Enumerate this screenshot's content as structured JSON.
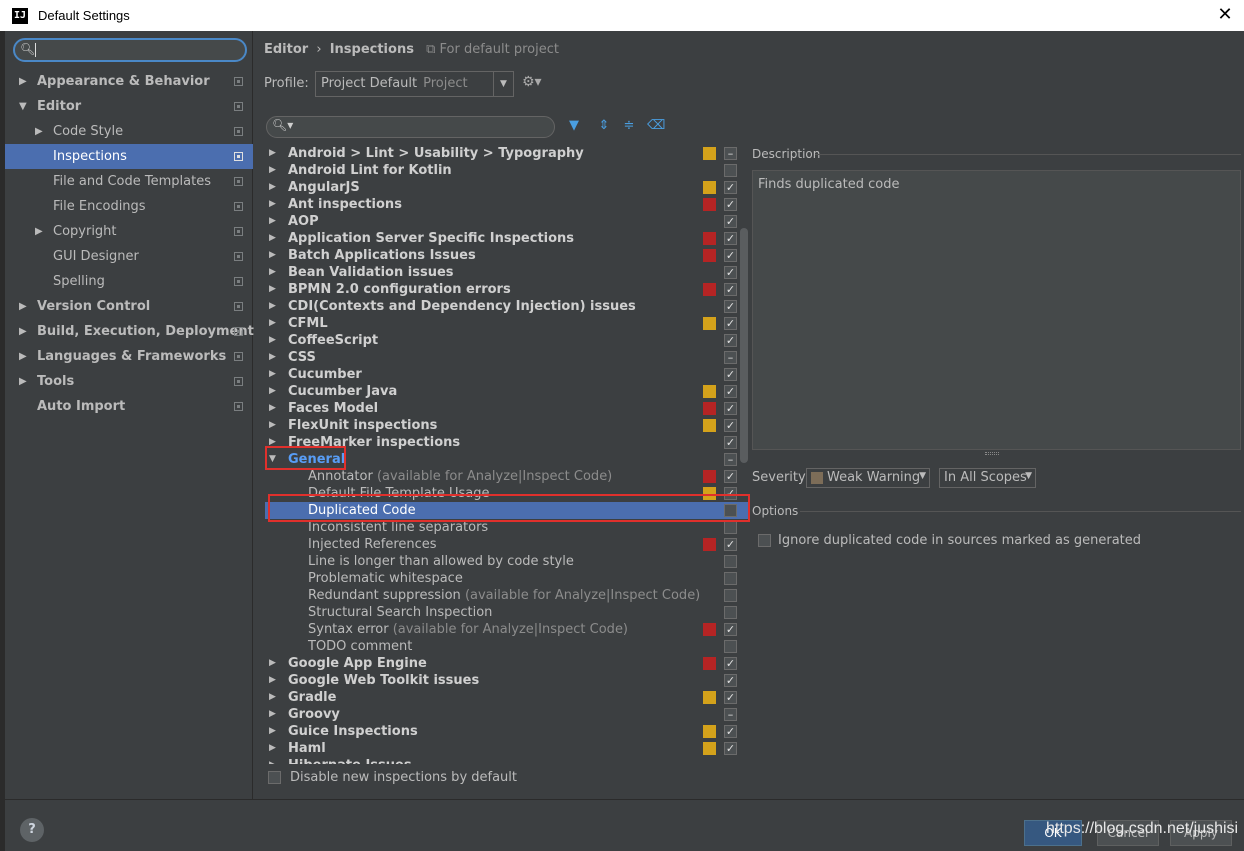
{
  "window": {
    "title": "Default Settings",
    "app_icon": "intellij-icon"
  },
  "sidebar": {
    "search": {
      "value": ""
    },
    "items": [
      {
        "label": "Appearance & Behavior",
        "level": 0,
        "arrow": "▶",
        "bold": true,
        "selected": false
      },
      {
        "label": "Editor",
        "level": 0,
        "arrow": "▼",
        "bold": true,
        "selected": false
      },
      {
        "label": "Code Style",
        "level": 1,
        "arrow": "▶",
        "bold": false,
        "selected": false
      },
      {
        "label": "Inspections",
        "level": 1,
        "arrow": "",
        "bold": false,
        "selected": true
      },
      {
        "label": "File and Code Templates",
        "level": 1,
        "arrow": "",
        "bold": false,
        "selected": false
      },
      {
        "label": "File Encodings",
        "level": 1,
        "arrow": "",
        "bold": false,
        "selected": false
      },
      {
        "label": "Copyright",
        "level": 1,
        "arrow": "▶",
        "bold": false,
        "selected": false
      },
      {
        "label": "GUI Designer",
        "level": 1,
        "arrow": "",
        "bold": false,
        "selected": false
      },
      {
        "label": "Spelling",
        "level": 1,
        "arrow": "",
        "bold": false,
        "selected": false
      },
      {
        "label": "Version Control",
        "level": 0,
        "arrow": "▶",
        "bold": true,
        "selected": false
      },
      {
        "label": "Build, Execution, Deployment",
        "level": 0,
        "arrow": "▶",
        "bold": true,
        "selected": false
      },
      {
        "label": "Languages & Frameworks",
        "level": 0,
        "arrow": "▶",
        "bold": true,
        "selected": false
      },
      {
        "label": "Tools",
        "level": 0,
        "arrow": "▶",
        "bold": true,
        "selected": false
      },
      {
        "label": "Auto Import",
        "level": 0,
        "arrow": "",
        "bold": true,
        "selected": false
      }
    ]
  },
  "header": {
    "crumb1": "Editor",
    "separator": "›",
    "crumb2": "Inspections",
    "note": "For default project",
    "profile_label": "Profile:",
    "profile_value": "Project Default",
    "profile_sub": "Project"
  },
  "tree": [
    {
      "type": "group",
      "name": "Android > Lint > Usability > Typography",
      "severity": "y",
      "check": "–"
    },
    {
      "type": "group",
      "name": "Android Lint for Kotlin",
      "severity": "",
      "check": ""
    },
    {
      "type": "group",
      "name": "AngularJS",
      "severity": "y",
      "check": "✓"
    },
    {
      "type": "group",
      "name": "Ant inspections",
      "severity": "r",
      "check": "✓"
    },
    {
      "type": "group",
      "name": "AOP",
      "severity": "",
      "check": "✓"
    },
    {
      "type": "group",
      "name": "Application Server Specific Inspections",
      "severity": "r",
      "check": "✓"
    },
    {
      "type": "group",
      "name": "Batch Applications Issues",
      "severity": "r",
      "check": "✓"
    },
    {
      "type": "group",
      "name": "Bean Validation issues",
      "severity": "",
      "check": "✓"
    },
    {
      "type": "group",
      "name": "BPMN 2.0 configuration errors",
      "severity": "r",
      "check": "✓"
    },
    {
      "type": "group",
      "name": "CDI(Contexts and Dependency Injection) issues",
      "severity": "",
      "check": "✓"
    },
    {
      "type": "group",
      "name": "CFML",
      "severity": "y",
      "check": "✓"
    },
    {
      "type": "group",
      "name": "CoffeeScript",
      "severity": "",
      "check": "✓"
    },
    {
      "type": "group",
      "name": "CSS",
      "severity": "",
      "check": "–"
    },
    {
      "type": "group",
      "name": "Cucumber",
      "severity": "",
      "check": "✓"
    },
    {
      "type": "group",
      "name": "Cucumber Java",
      "severity": "y",
      "check": "✓"
    },
    {
      "type": "group",
      "name": "Faces Model",
      "severity": "r",
      "check": "✓"
    },
    {
      "type": "group",
      "name": "FlexUnit inspections",
      "severity": "y",
      "check": "✓"
    },
    {
      "type": "group",
      "name": "FreeMarker inspections",
      "severity": "",
      "check": "✓"
    },
    {
      "type": "general",
      "name": "General",
      "severity": "",
      "check": "–"
    },
    {
      "type": "child",
      "name": "Annotator",
      "avail": "(available for Analyze|Inspect Code)",
      "severity": "r",
      "check": "✓"
    },
    {
      "type": "child",
      "name": "Default File Template Usage",
      "severity": "y",
      "check": "✓"
    },
    {
      "type": "child-sel",
      "name": "Duplicated Code",
      "severity": "",
      "check": ""
    },
    {
      "type": "child",
      "name": "Inconsistent line separators",
      "severity": "",
      "check": ""
    },
    {
      "type": "child",
      "name": "Injected References",
      "severity": "r",
      "check": "✓"
    },
    {
      "type": "child",
      "name": "Line is longer than allowed by code style",
      "severity": "",
      "check": ""
    },
    {
      "type": "child",
      "name": "Problematic whitespace",
      "severity": "",
      "check": ""
    },
    {
      "type": "child",
      "name": "Redundant suppression",
      "avail": "(available for Analyze|Inspect Code)",
      "severity": "",
      "check": ""
    },
    {
      "type": "child",
      "name": "Structural Search Inspection",
      "severity": "",
      "check": ""
    },
    {
      "type": "child",
      "name": "Syntax error",
      "avail": "(available for Analyze|Inspect Code)",
      "severity": "r",
      "check": "✓"
    },
    {
      "type": "child",
      "name": "TODO comment",
      "severity": "",
      "check": ""
    },
    {
      "type": "group",
      "name": "Google App Engine",
      "severity": "r",
      "check": "✓"
    },
    {
      "type": "group",
      "name": "Google Web Toolkit issues",
      "severity": "",
      "check": "✓"
    },
    {
      "type": "group",
      "name": "Gradle",
      "severity": "y",
      "check": "✓"
    },
    {
      "type": "group",
      "name": "Groovy",
      "severity": "",
      "check": "–"
    },
    {
      "type": "group",
      "name": "Guice Inspections",
      "severity": "y",
      "check": "✓"
    },
    {
      "type": "group",
      "name": "Haml",
      "severity": "y",
      "check": "✓"
    },
    {
      "type": "cut",
      "name": "Hibernate Issues",
      "severity": "",
      "check": ""
    }
  ],
  "disable_new": "Disable new inspections by default",
  "description": {
    "title": "Description",
    "text": "Finds duplicated code"
  },
  "severity": {
    "label": "Severity:",
    "value": "Weak Warning",
    "scope": "In All Scopes"
  },
  "options": {
    "title": "Options",
    "ignore_label": "Ignore duplicated code in sources marked as generated"
  },
  "footer": {
    "help": "?",
    "ok": "OK",
    "cancel": "Cancel",
    "apply": "Apply",
    "watermark": "https://blog.csdn.net/jushisi"
  },
  "colors": {
    "selection": "#4b6eaf",
    "warning_yellow": "#d4a21b",
    "error_red": "#b52424",
    "annotation_red": "#e0302c"
  }
}
